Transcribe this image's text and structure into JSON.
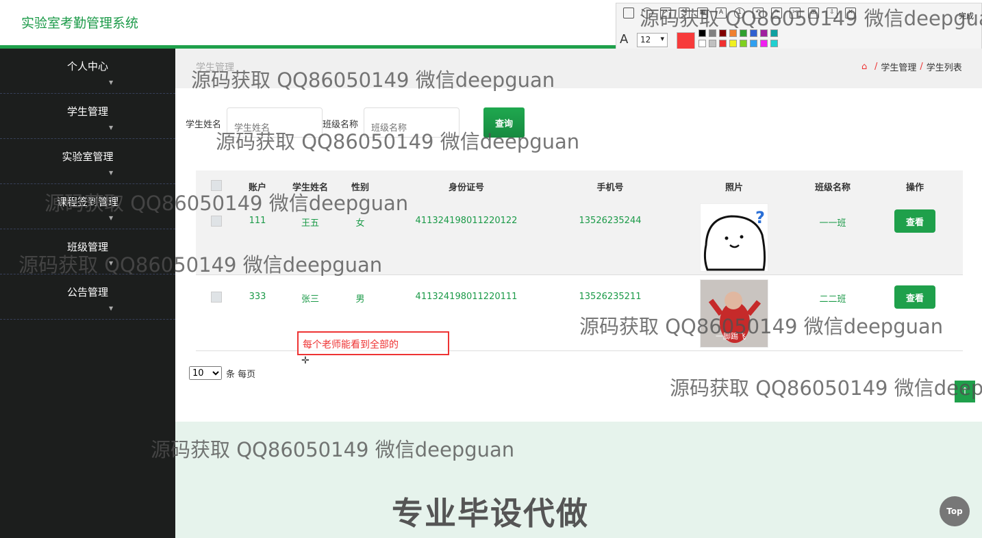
{
  "app": {
    "title": "实验室考勤管理系统"
  },
  "snip_toolbar": {
    "done_label": "完成",
    "font_size": "12",
    "current_color": "#f73b3b",
    "palette": [
      "#000000",
      "#808080",
      "#800000",
      "#f08030",
      "#30a030",
      "#3060d0",
      "#a020a0",
      "#10a0a0",
      "#ffffff",
      "#c0c0c0",
      "#f03030",
      "#f0f020",
      "#80d020",
      "#30a0f0",
      "#f020f0",
      "#20d0d0"
    ]
  },
  "sidebar": {
    "items": [
      {
        "label": "个人中心"
      },
      {
        "label": "学生管理"
      },
      {
        "label": "实验室管理"
      },
      {
        "label": "课程签到管理"
      },
      {
        "label": "班级管理"
      },
      {
        "label": "公告管理"
      }
    ]
  },
  "header": {
    "title": "学生管理",
    "breadcrumb": [
      "学生管理",
      "学生列表"
    ],
    "breadcrumb_sep": "/"
  },
  "search": {
    "name_label": "学生姓名",
    "name_placeholder": "学生姓名",
    "class_label": "班级名称",
    "class_placeholder": "班级名称",
    "button": "查询"
  },
  "table": {
    "columns": [
      "账户",
      "学生姓名",
      "性别",
      "身份证号",
      "手机号",
      "照片",
      "班级名称",
      "操作"
    ],
    "rows": [
      {
        "account": "111",
        "name": "王五",
        "gender": "女",
        "id_number": "411324198011220122",
        "phone": "13526235244",
        "class": "一一班",
        "action": "查看"
      },
      {
        "account": "333",
        "name": "张三",
        "gender": "男",
        "id_number": "411324198011220111",
        "phone": "13526235211",
        "class": "二二班",
        "action": "查看",
        "photo_caption": "一脚踢飞"
      }
    ]
  },
  "pager": {
    "page_size": "10",
    "suffix": "条 每页"
  },
  "annotation": {
    "text": "每个老师能看到全部的"
  },
  "watermark": {
    "text": "源码获取 QQ86050149 微信deepguan",
    "footer": "专业毕设代做"
  },
  "buttons": {
    "top": "Top",
    "up": "↑"
  }
}
